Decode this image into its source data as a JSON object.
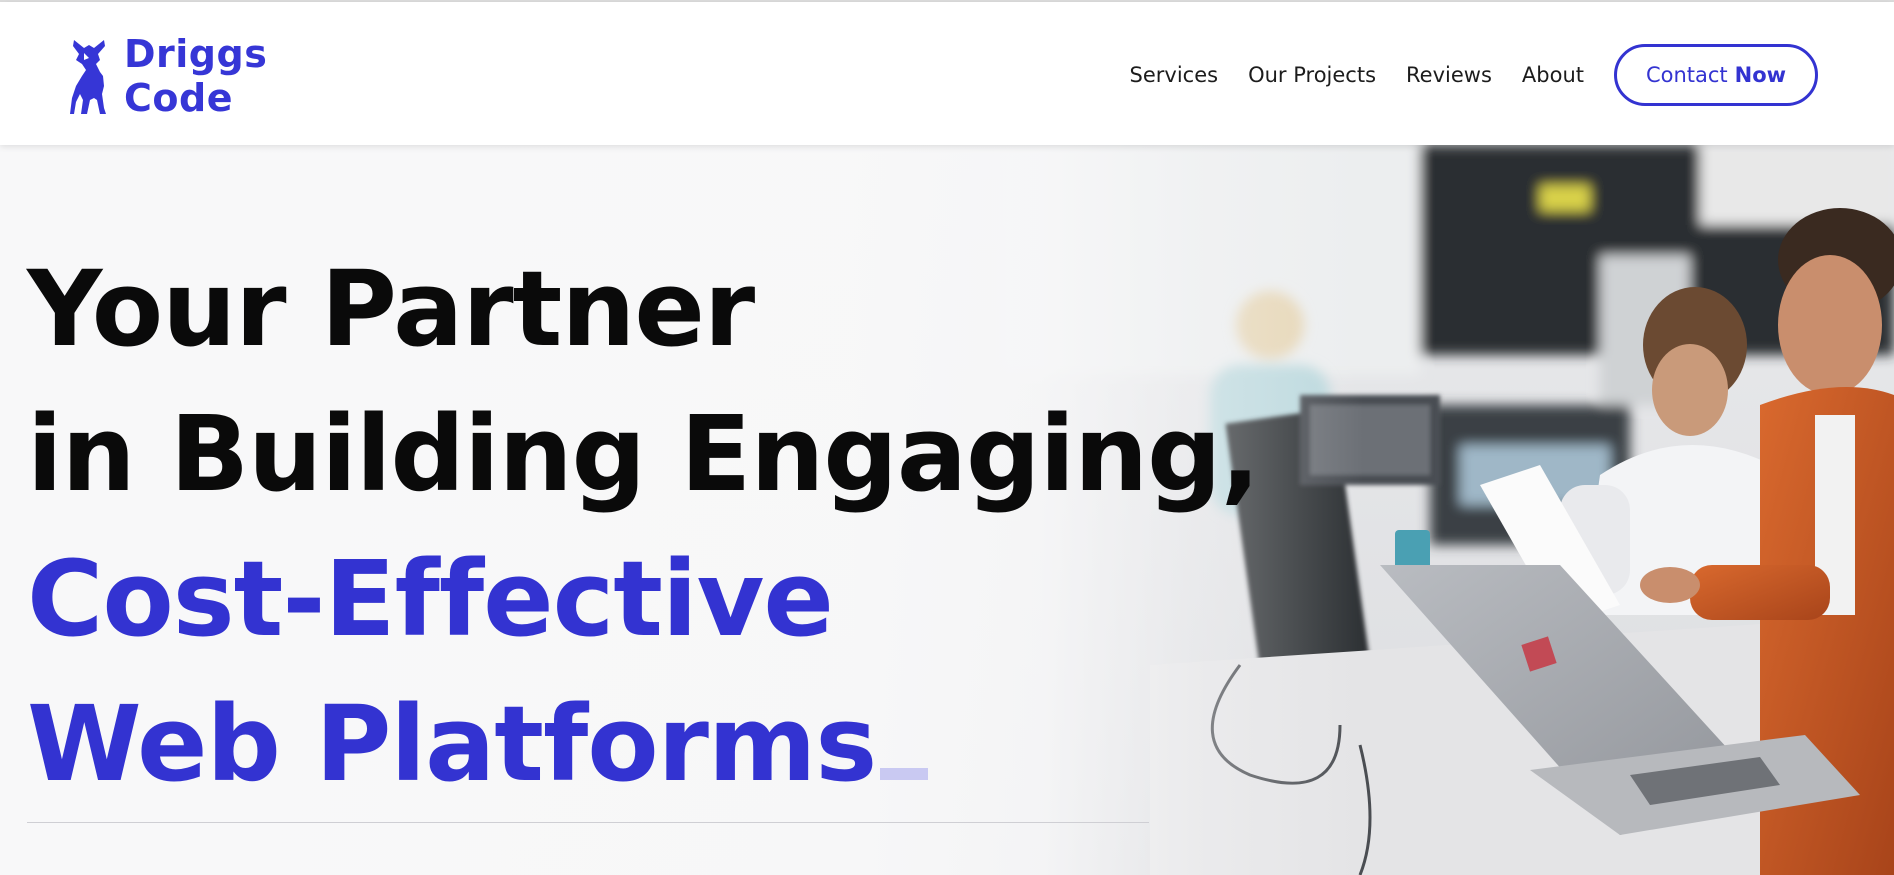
{
  "brand": {
    "name_line1": "Driggs",
    "name_line2": "Code",
    "color": "#3636d6",
    "icon": "donkey-icon"
  },
  "nav": {
    "items": [
      {
        "label": "Services"
      },
      {
        "label": "Our Projects"
      },
      {
        "label": "Reviews"
      },
      {
        "label": "About"
      }
    ],
    "contact": {
      "label_regular": "Contact",
      "label_bold": "Now"
    }
  },
  "hero": {
    "line1": "Your Partner",
    "line2": "in Building Engaging,",
    "line3": "Cost-Effective",
    "line4": "Web Platforms",
    "image": "office-team-photo",
    "accent_color": "#3333d1"
  }
}
